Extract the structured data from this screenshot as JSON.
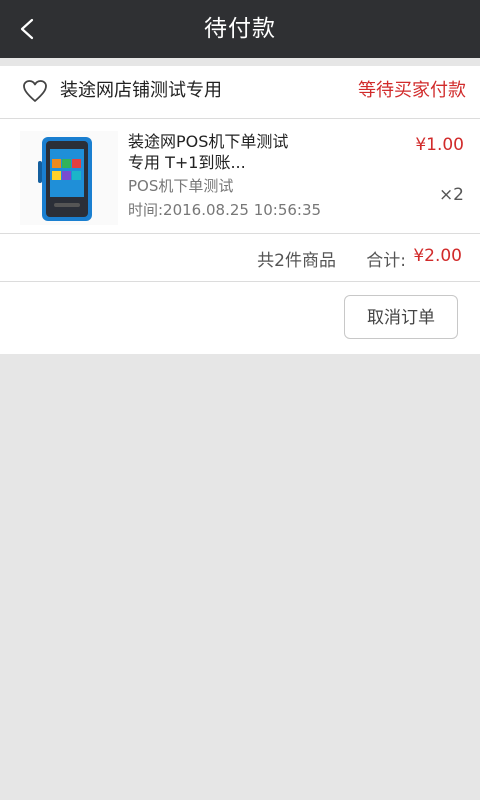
{
  "header": {
    "title": "待付款",
    "back_icon": "chevron-left-icon"
  },
  "order": {
    "shop_icon": "heart-icon",
    "shop_name": "装途网店铺测试专用",
    "status": "等待买家付款",
    "status_color": "#d12b2b",
    "item": {
      "name_line1": "装途网POS机下单测试",
      "name_line2": "专用 T+1到账...",
      "subtitle": "POS机下单测试",
      "time": "时间:2016.08.25 10:56:35",
      "price": "¥1.00",
      "quantity": "×2"
    },
    "summary": {
      "count": "共2件商品",
      "total_label": "合计:",
      "total_value": "¥2.00"
    },
    "actions": {
      "cancel_label": "取消订单"
    }
  },
  "colors": {
    "header_bg": "#2f3033",
    "accent_red": "#d12b2b",
    "page_bg": "#e6e6e6"
  }
}
